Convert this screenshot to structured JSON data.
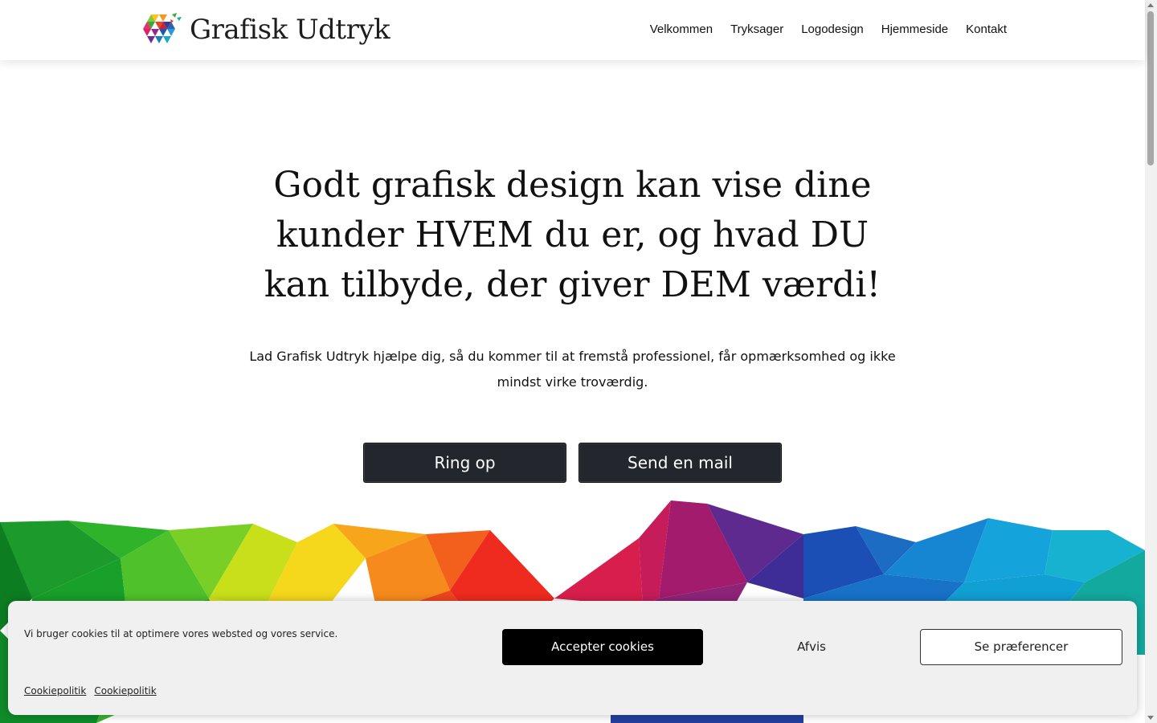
{
  "header": {
    "logo_text": "Grafisk Udtryk",
    "nav": [
      "Velkommen",
      "Tryksager",
      "Logodesign",
      "Hjemmeside",
      "Kontakt"
    ]
  },
  "hero": {
    "title": "Godt grafisk design kan vise dine kunder HVEM du er, og hvad DU kan tilbyde, der giver DEM værdi!",
    "subtitle": "Lad Grafisk Udtryk hjælpe dig, så du kommer til at fremstå professionel, får opmærksomhed og ikke mindst virke troværdig.",
    "call_button": "Ring op",
    "mail_button": "Send en mail"
  },
  "cookie_banner": {
    "message": "Vi bruger cookies til at optimere vores websted og vores service.",
    "accept_label": "Accepter cookies",
    "deny_label": "Afvis",
    "preferences_label": "Se præferencer",
    "links": [
      "Cookiepolitik",
      "Cookiepolitik"
    ]
  },
  "colors": {
    "button_dark": "#23272d",
    "accept_bg": "#000000",
    "banner_bg": "#f0f0f0"
  }
}
